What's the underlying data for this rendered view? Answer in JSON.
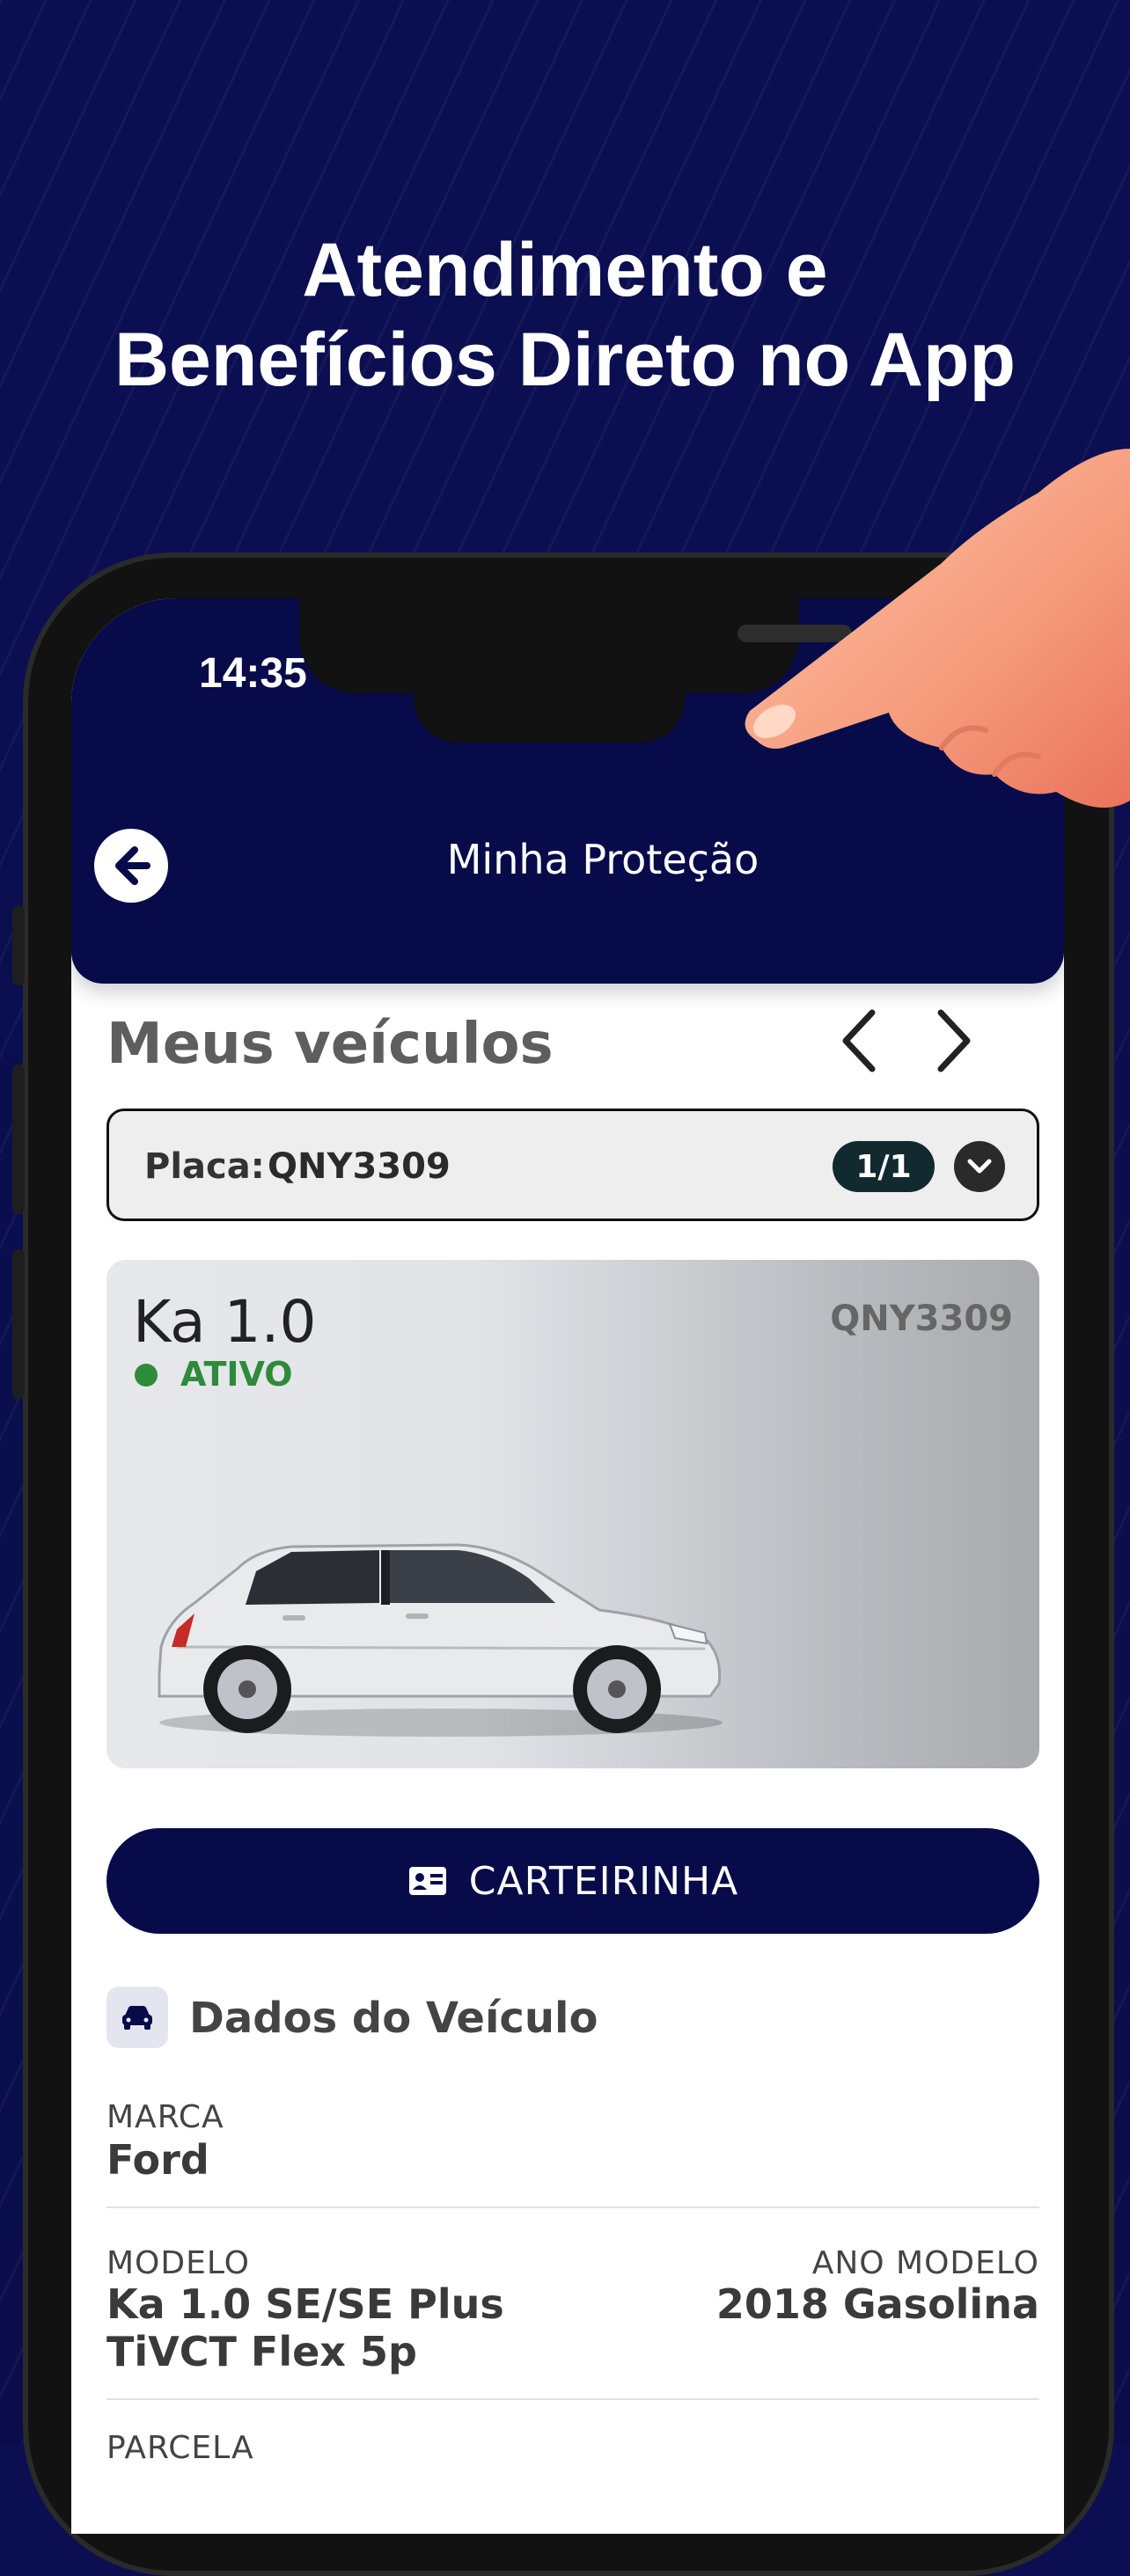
{
  "promo": {
    "headline_line1": "Atendimento e",
    "headline_line2": "Benefícios Direto no App"
  },
  "status_bar": {
    "time": "14:35"
  },
  "header": {
    "title": "Minha Proteção"
  },
  "vehicles": {
    "section_title": "Meus veículos",
    "plate_label": "Placa:",
    "plate_value": "QNY3309",
    "count": "1/1"
  },
  "vehicle_card": {
    "model": "Ka 1.0",
    "status": "ATIVO",
    "plate": "QNY3309",
    "status_color": "#2e8b3a"
  },
  "card_button": {
    "label": "CARTEIRINHA"
  },
  "vehicle_data": {
    "title": "Dados do Veículo",
    "brand_label": "MARCA",
    "brand_value": "Ford",
    "model_label": "MODELO",
    "model_value_line1": "Ka 1.0 SE/SE Plus",
    "model_value_line2": "TiVCT Flex 5p",
    "year_label": "ANO MODELO",
    "year_value": "2018 Gasolina",
    "next_label": "PARCELA"
  },
  "colors": {
    "brand_navy": "#070b4a",
    "background": "#0b0f52",
    "active_green": "#2e8b3a"
  }
}
